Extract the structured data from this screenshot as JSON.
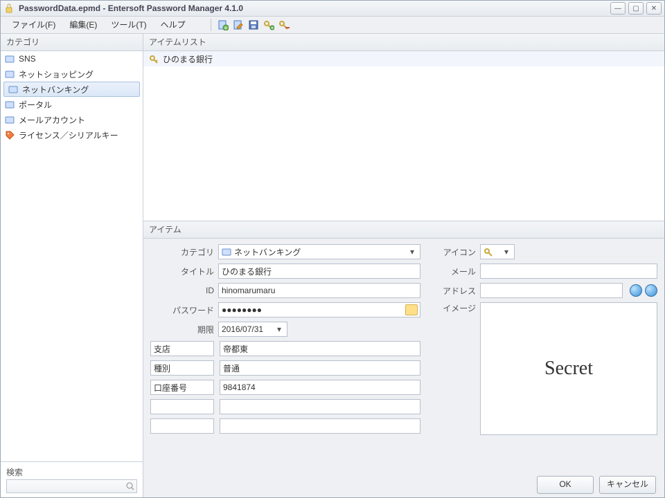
{
  "titlebar": {
    "title": "PasswordData.epmd - Entersoft Password Manager 4.1.0"
  },
  "menu": {
    "file": "ファイル(F)",
    "edit": "編集(E)",
    "tool": "ツール(T)",
    "help": "ヘルプ"
  },
  "sidebar": {
    "header": "カテゴリ",
    "items": [
      {
        "label": "SNS"
      },
      {
        "label": "ネットショッピング"
      },
      {
        "label": "ネットバンキング"
      },
      {
        "label": "ポータル"
      },
      {
        "label": "メールアカウント"
      },
      {
        "label": "ライセンス／シリアルキー"
      }
    ],
    "selected_index": 2,
    "search_label": "検索"
  },
  "itemlist": {
    "header": "アイテムリスト",
    "rows": [
      {
        "label": "ひのまる銀行"
      }
    ]
  },
  "detail": {
    "header": "アイテム",
    "labels": {
      "category": "カテゴリ",
      "title": "タイトル",
      "id": "ID",
      "password": "パスワード",
      "expire": "期限",
      "icon": "アイコン",
      "mail": "メール",
      "address": "アドレス",
      "image": "イメージ"
    },
    "values": {
      "category": "ネットバンキング",
      "title": "ひのまる銀行",
      "id": "hinomarumaru",
      "password_mask": "●●●●●●●●",
      "expire": "2016/07/31",
      "mail": "",
      "address": "",
      "image_text": "Secret"
    },
    "custom": [
      {
        "name": "支店",
        "value": "帝都東"
      },
      {
        "name": "種別",
        "value": "普通"
      },
      {
        "name": "口座番号",
        "value": "9841874"
      },
      {
        "name": "",
        "value": ""
      },
      {
        "name": "",
        "value": ""
      }
    ]
  },
  "footer": {
    "ok": "OK",
    "cancel": "キャンセル"
  }
}
